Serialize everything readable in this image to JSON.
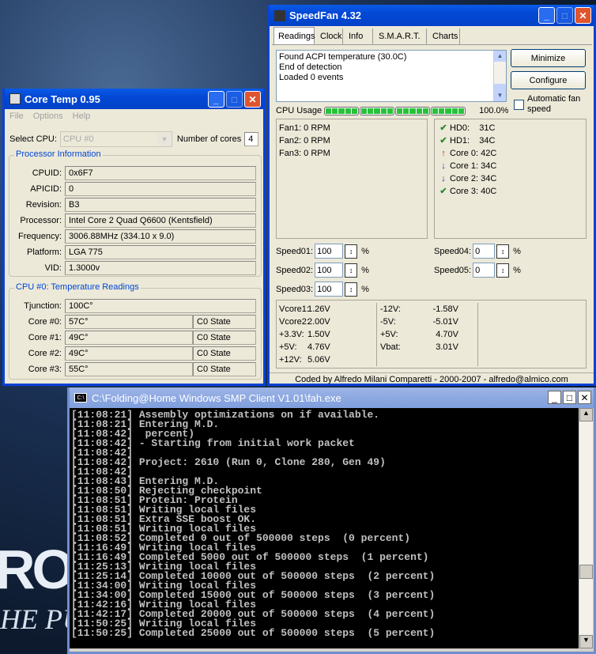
{
  "wallpaper": {
    "logo": "RO",
    "tagline": "HE PUR"
  },
  "coretemp": {
    "title": "Core Temp 0.95",
    "menu": [
      "File",
      "Options",
      "Help"
    ],
    "select_cpu_label": "Select CPU:",
    "select_cpu_value": "CPU #0",
    "cores_label": "Number of cores",
    "cores_value": "4",
    "proc_group": "Processor Information",
    "proc": [
      {
        "label": "CPUID:",
        "value": "0x6F7"
      },
      {
        "label": "APICID:",
        "value": "0"
      },
      {
        "label": "Revision:",
        "value": "B3"
      },
      {
        "label": "Processor:",
        "value": "Intel Core 2 Quad Q6600 (Kentsfield)"
      },
      {
        "label": "Frequency:",
        "value": "3006.88MHz (334.10 x 9.0)"
      },
      {
        "label": "Platform:",
        "value": "LGA 775"
      },
      {
        "label": "VID:",
        "value": "1.3000v"
      }
    ],
    "temp_group": "CPU #0: Temperature Readings",
    "tjunction_label": "Tjunction:",
    "tjunction_value": "100C°",
    "cores": [
      {
        "label": "Core #0:",
        "temp": "57C°",
        "state": "C0 State"
      },
      {
        "label": "Core #1:",
        "temp": "49C°",
        "state": "C0 State"
      },
      {
        "label": "Core #2:",
        "temp": "49C°",
        "state": "C0 State"
      },
      {
        "label": "Core #3:",
        "temp": "55C°",
        "state": "C0 State"
      }
    ]
  },
  "speedfan": {
    "title": "SpeedFan 4.32",
    "tabs": [
      "Readings",
      "Clock",
      "Info",
      "S.M.A.R.T.",
      "Charts"
    ],
    "log": [
      "Found ACPI temperature (30.0C)",
      "End of detection",
      "Loaded 0 events"
    ],
    "minimize": "Minimize",
    "configure": "Configure",
    "auto_fan": "Automatic fan speed",
    "cpu_usage_label": "CPU Usage",
    "cpu_usage_value": "100.0%",
    "cpu_usage_fraction": 1.0,
    "fans": [
      "Fan1: 0 RPM",
      "Fan2: 0 RPM",
      "Fan3: 0 RPM"
    ],
    "temps": [
      {
        "icon": "check",
        "text": "HD0:    31C"
      },
      {
        "icon": "check",
        "text": "HD1:    34C"
      },
      {
        "icon": "up",
        "text": "Core 0: 42C"
      },
      {
        "icon": "down",
        "text": "Core 1: 34C"
      },
      {
        "icon": "down",
        "text": "Core 2: 34C"
      },
      {
        "icon": "check",
        "text": "Core 3: 40C"
      }
    ],
    "speeds": [
      {
        "label": "Speed01:",
        "value": "100"
      },
      {
        "label": "Speed02:",
        "value": "100"
      },
      {
        "label": "Speed03:",
        "value": "100"
      },
      {
        "label": "Speed04:",
        "value": "0"
      },
      {
        "label": "Speed05:",
        "value": "0"
      }
    ],
    "percent": "%",
    "volts_a": [
      [
        "Vcore1:",
        "1.26V"
      ],
      [
        "Vcore2:",
        "2.00V"
      ],
      [
        "+3.3V:",
        "1.50V"
      ],
      [
        "+5V:",
        "4.76V"
      ],
      [
        "+12V:",
        "5.06V"
      ]
    ],
    "volts_b": [
      [
        "-12V:",
        "-1.58V"
      ],
      [
        "-5V:",
        "-5.01V"
      ],
      [
        "+5V:",
        "4.70V"
      ],
      [
        "Vbat:",
        "3.01V"
      ]
    ],
    "footer": "Coded by Alfredo Milani Comparetti - 2000-2007 - alfredo@almico.com"
  },
  "console": {
    "title": "C:\\Folding@Home Windows SMP Client V1.01\\fah.exe",
    "lines": [
      "[11:08:21] Assembly optimizations on if available.",
      "[11:08:21] Entering M.D.",
      "[11:08:42]  percent)",
      "[11:08:42] - Starting from initial work packet",
      "[11:08:42]",
      "[11:08:42] Project: 2610 (Run 0, Clone 280, Gen 49)",
      "[11:08:42]",
      "[11:08:43] Entering M.D.",
      "[11:08:50] Rejecting checkpoint",
      "[11:08:51] Protein: Protein",
      "[11:08:51] Writing local files",
      "[11:08:51] Extra SSE boost OK.",
      "[11:08:51] Writing local files",
      "[11:08:52] Completed 0 out of 500000 steps  (0 percent)",
      "[11:16:49] Writing local files",
      "[11:16:49] Completed 5000 out of 500000 steps  (1 percent)",
      "[11:25:13] Writing local files",
      "[11:25:14] Completed 10000 out of 500000 steps  (2 percent)",
      "[11:34:00] Writing local files",
      "[11:34:00] Completed 15000 out of 500000 steps  (3 percent)",
      "[11:42:16] Writing local files",
      "[11:42:17] Completed 20000 out of 500000 steps  (4 percent)",
      "[11:50:25] Writing local files",
      "[11:50:25] Completed 25000 out of 500000 steps  (5 percent)"
    ]
  }
}
